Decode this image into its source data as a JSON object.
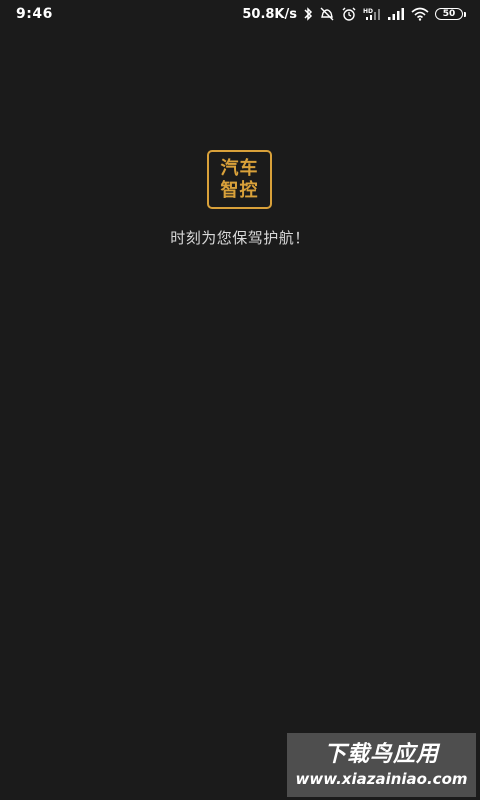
{
  "status_bar": {
    "time": "9:46",
    "net_speed": "50.8K/s",
    "battery_level": "50",
    "icons": [
      "bluetooth-icon",
      "mute-icon",
      "alarm-icon",
      "hd-signal-icon",
      "signal-icon",
      "wifi-icon",
      "battery-icon"
    ]
  },
  "logo": {
    "line1": "汽车",
    "line2": "智控",
    "color": "#d9a13a"
  },
  "tagline": "时刻为您保驾护航！",
  "watermark": {
    "title": "下载鸟应用",
    "url": "www.xiazainiao.com"
  },
  "colors": {
    "background": "#1b1b1b",
    "accent": "#d9a13a"
  }
}
